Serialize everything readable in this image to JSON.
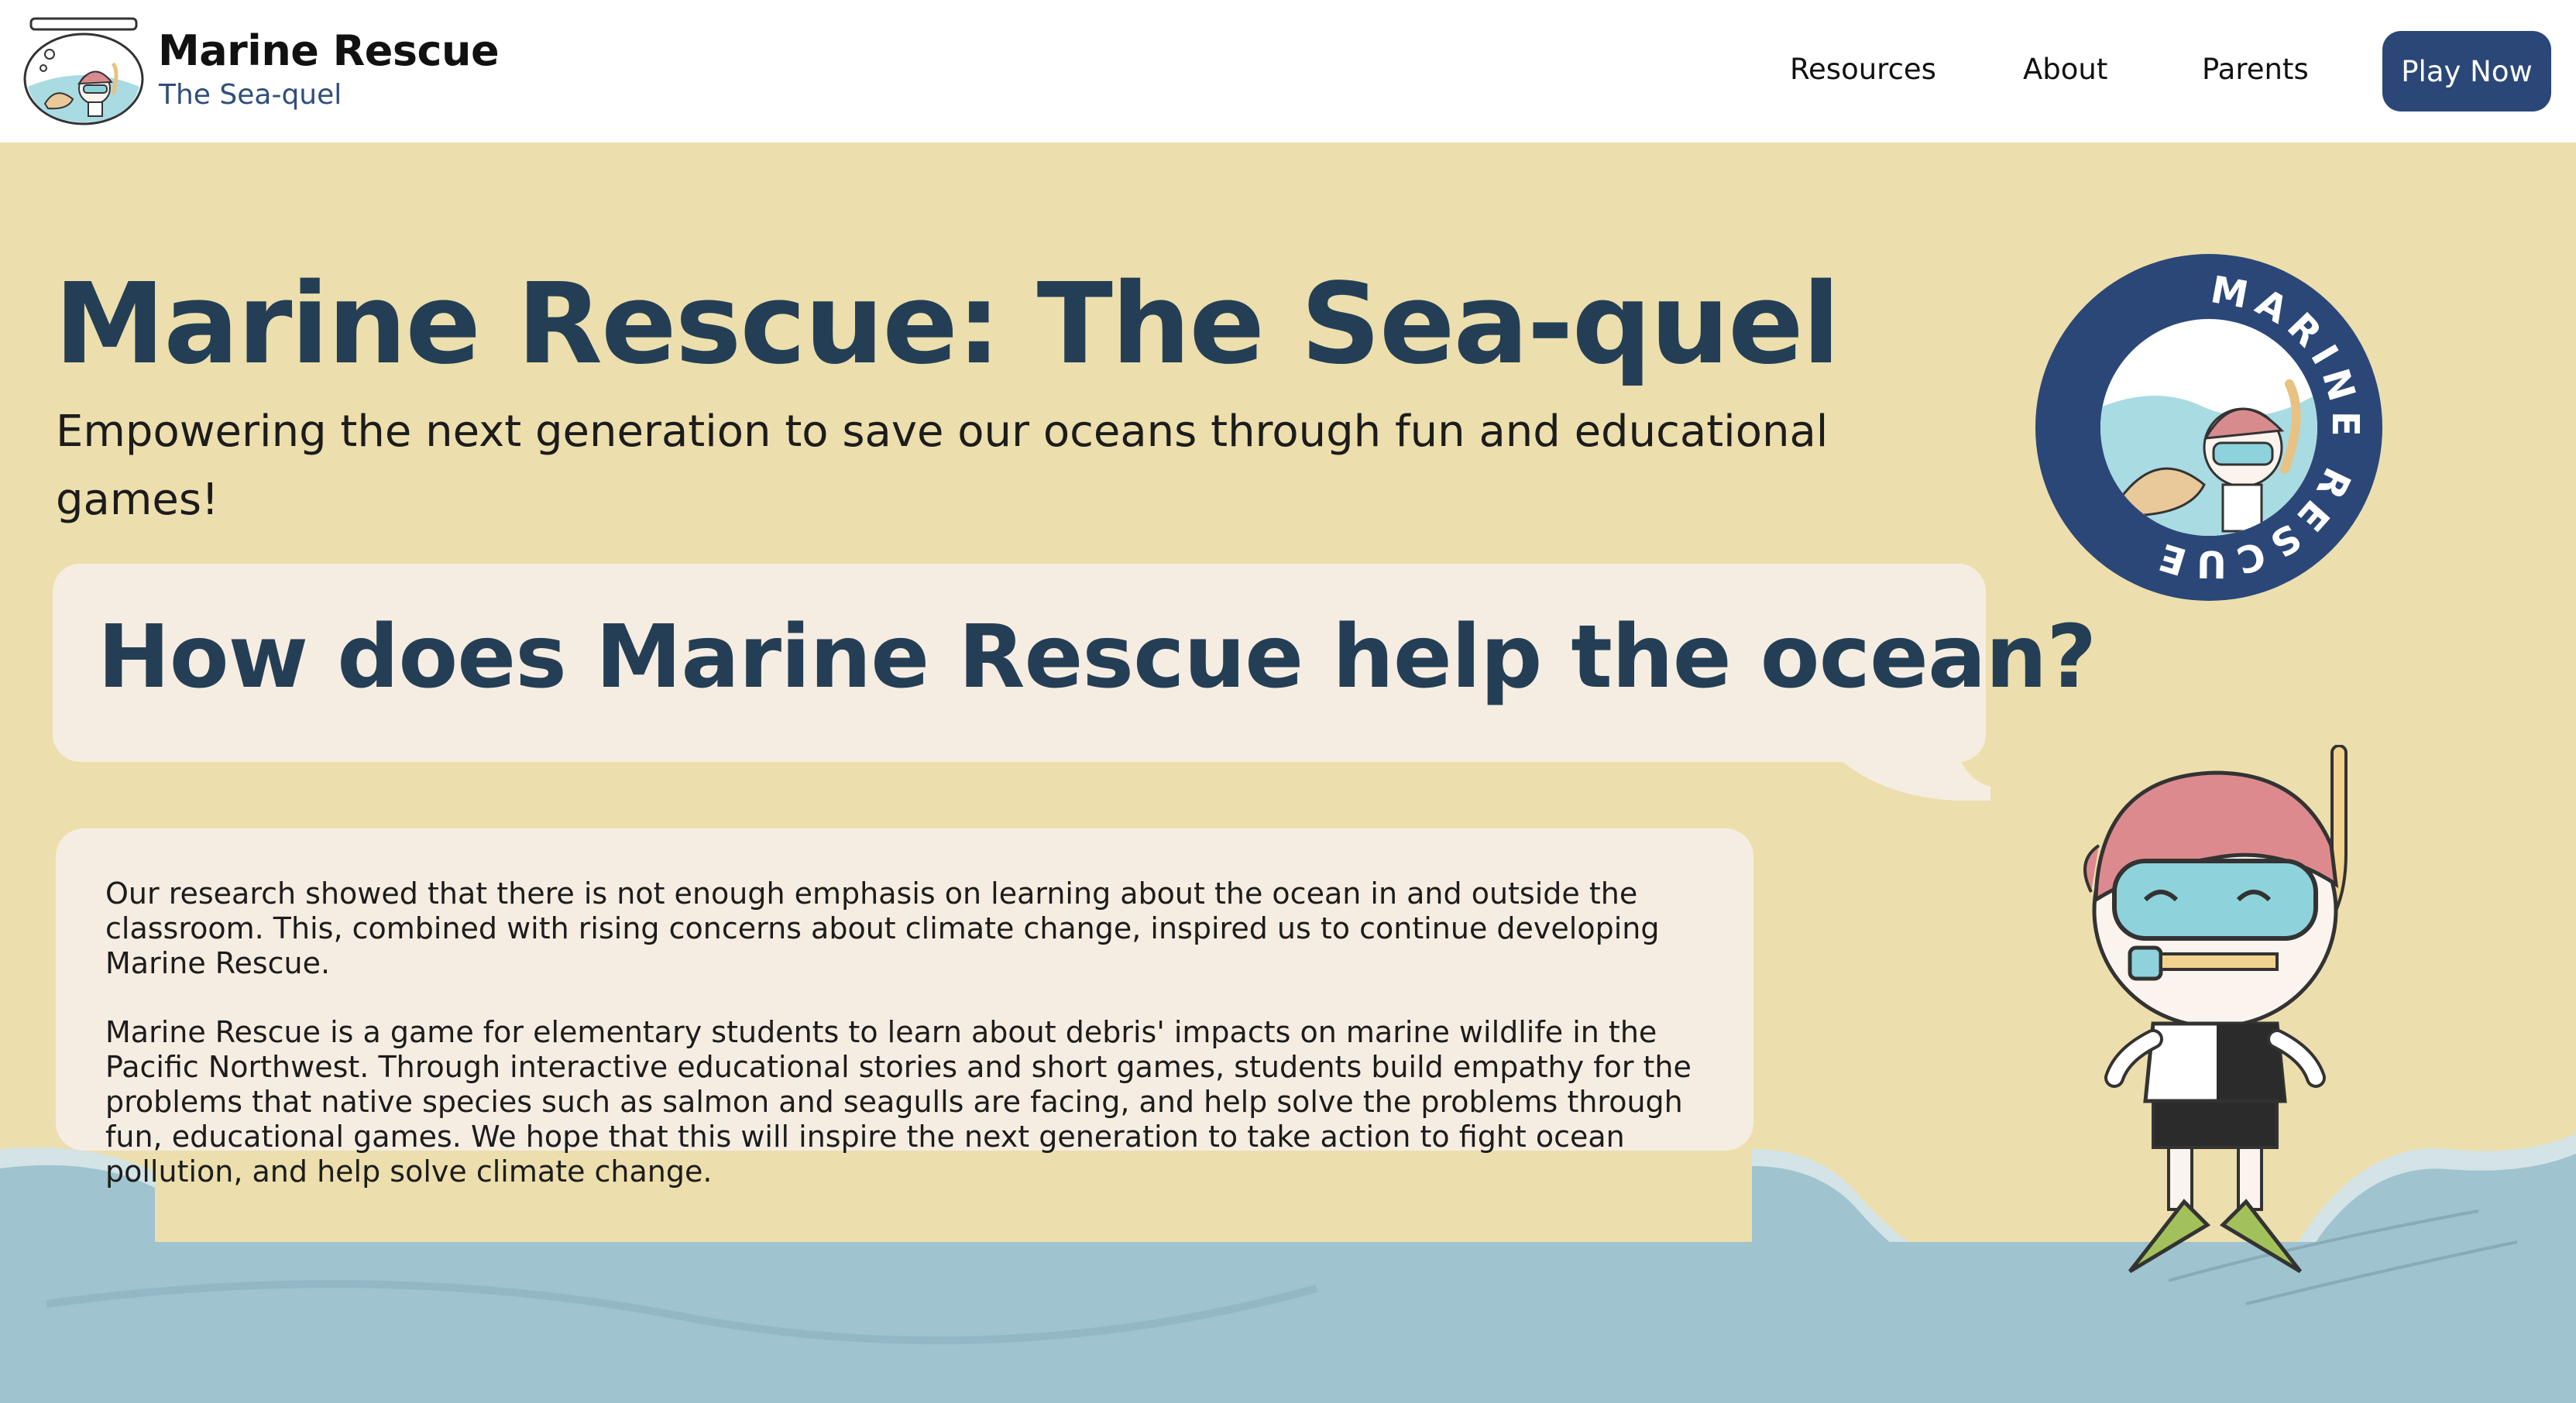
{
  "brand": {
    "title": "Marine Rescue",
    "subtitle": "The Sea-quel",
    "logo_icon": "fishbowl-diver-logo-icon"
  },
  "nav": {
    "links": [
      {
        "label": "Resources"
      },
      {
        "label": "About"
      },
      {
        "label": "Parents"
      }
    ],
    "cta_label": "Play Now"
  },
  "hero": {
    "title": "Marine Rescue: The Sea-quel",
    "tagline": "Empowering the next generation to save our oceans through fun and educational games!",
    "question": "How does Marine Rescue help the ocean?",
    "paragraphs": [
      "Our research showed that there is not enough emphasis on learning about the ocean in and outside the classroom. This, combined with rising concerns about climate change, inspired us to continue developing Marine Rescue.",
      "Marine Rescue is a game for elementary students to learn about debris' impacts on marine wildlife in the Pacific Northwest. Through interactive educational stories and short games, students build empathy for the problems that native species such as salmon and seagulls are facing, and help solve the problems through fun, educational games. We hope that this will inspire the next generation to take action to fight ocean pollution, and help solve climate change."
    ]
  },
  "badge": {
    "ring_text": "MARINE RESCUE",
    "icon": "marine-rescue-badge-icon"
  },
  "mascot": {
    "icon": "snorkel-diver-mascot-icon"
  },
  "colors": {
    "background": "#ecdfad",
    "heading": "#243f55",
    "nav_button": "#2b4778",
    "card": "#f6ede2",
    "wave": "#9fc3cf"
  }
}
